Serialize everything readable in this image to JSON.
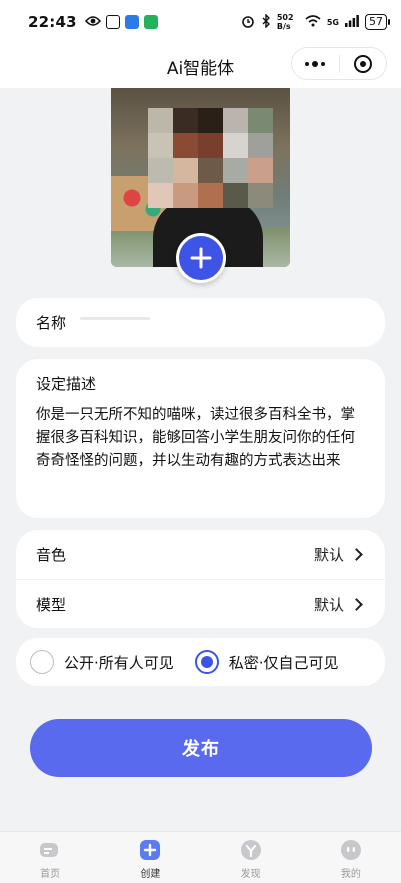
{
  "status_bar": {
    "time": "22:43",
    "network_speed": "502 B/s",
    "signal": "5G",
    "battery": "57"
  },
  "title_bar": {
    "title": "Ai智能体"
  },
  "form": {
    "name_label": "名称",
    "desc_label": "设定描述",
    "desc_text": "你是一只无所不知的喵咪，读过很多百科全书，掌握很多百科知识，能够回答小学生朋友问你的任何奇奇怪怪的问题，并以生动有趣的方式表达出来",
    "voice_label": "音色",
    "voice_value": "默认",
    "model_label": "模型",
    "model_value": "默认",
    "public_label": "公开·所有人可见",
    "private_label": "私密·仅自己可见",
    "selected_visibility": "private"
  },
  "publish_label": "发布",
  "tabs": [
    {
      "label": "首页",
      "icon": "home-icon"
    },
    {
      "label": "创建",
      "icon": "create-icon"
    },
    {
      "label": "发现",
      "icon": "discover-icon"
    },
    {
      "label": "我的",
      "icon": "profile-icon"
    }
  ],
  "colors": {
    "accent": "#3d54e6",
    "publish_button": "#5a6aee"
  }
}
